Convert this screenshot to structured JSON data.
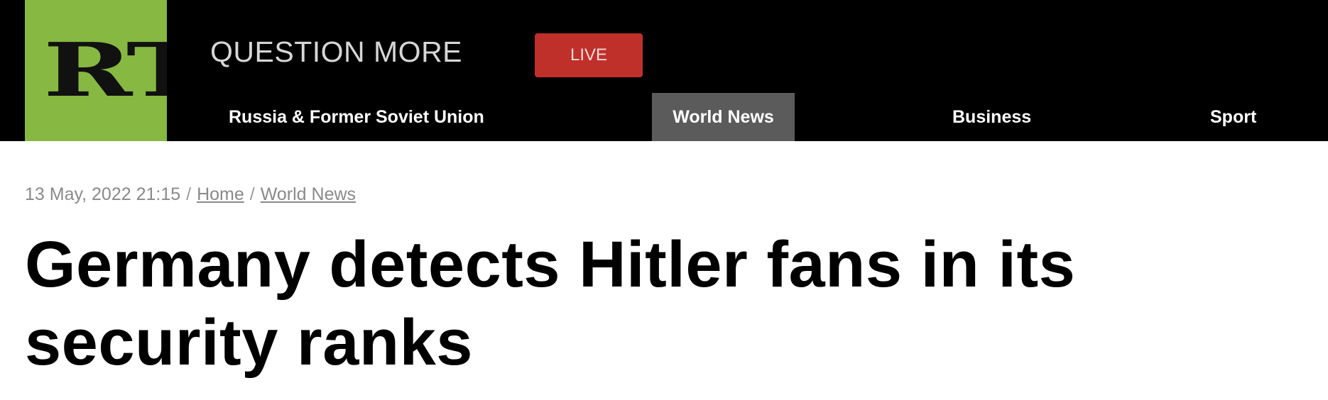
{
  "header": {
    "logo_text": "RT",
    "slogan": "QUESTION MORE",
    "live_label": "LIVE",
    "brand_green": "#86b842",
    "live_red": "#c0302a"
  },
  "nav": {
    "items": [
      {
        "label": "Russia & Former Soviet Union",
        "active": false
      },
      {
        "label": "World News",
        "active": true
      },
      {
        "label": "Business",
        "active": false
      },
      {
        "label": "Sport",
        "active": false
      }
    ]
  },
  "article": {
    "datetime": "13 May, 2022 21:15",
    "breadcrumb": [
      "Home",
      "World News"
    ],
    "separator": "/",
    "headline": "Germany detects Hitler fans in its security ranks"
  }
}
